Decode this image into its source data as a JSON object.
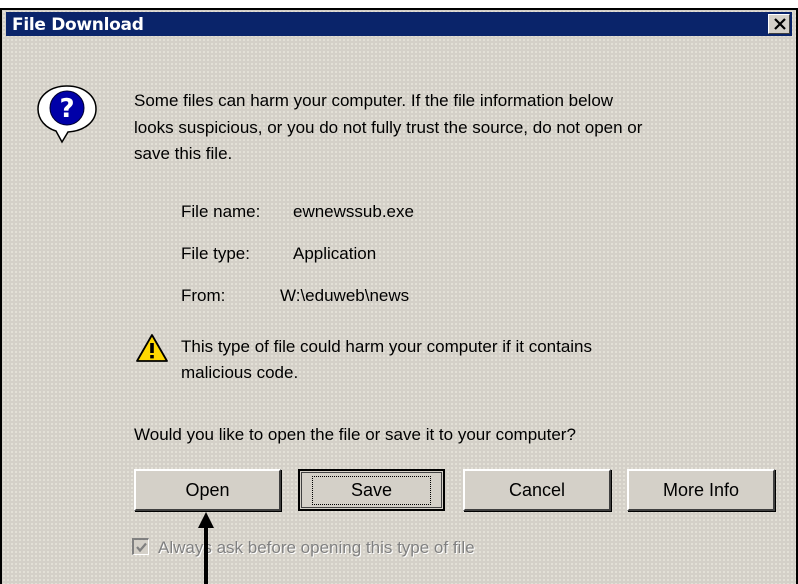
{
  "dialog": {
    "title": "File Download",
    "close_label": "Close",
    "message_line1": "Some files can harm your computer. If the file information below",
    "message_line2": "looks suspicious, or you do not fully trust the source, do not open or",
    "message_line3": "save this file.",
    "file_info": {
      "name_label": "File name:",
      "name_value": "ewnewssub.exe",
      "type_label": "File type:",
      "type_value": "Application",
      "from_label": "From:",
      "from_value": "W:\\eduweb\\news"
    },
    "warning_line1": "This type of file could harm your computer if it contains",
    "warning_line2": "malicious code.",
    "question": "Would you like to open the file or save it to your computer?",
    "buttons": {
      "open": "Open",
      "save": "Save",
      "cancel": "Cancel",
      "more_info": "More Info"
    },
    "checkbox": {
      "label": "Always ask before opening this type of file",
      "checked": true,
      "enabled": false
    }
  },
  "icons": {
    "help": "help-icon",
    "warning": "warning-icon",
    "close": "close-icon",
    "arrow": "arrow-pointer-icon"
  },
  "colors": {
    "titlebar": "#0a246a",
    "dialog_bg": "#d4d0c8",
    "disabled_text": "#808080"
  }
}
